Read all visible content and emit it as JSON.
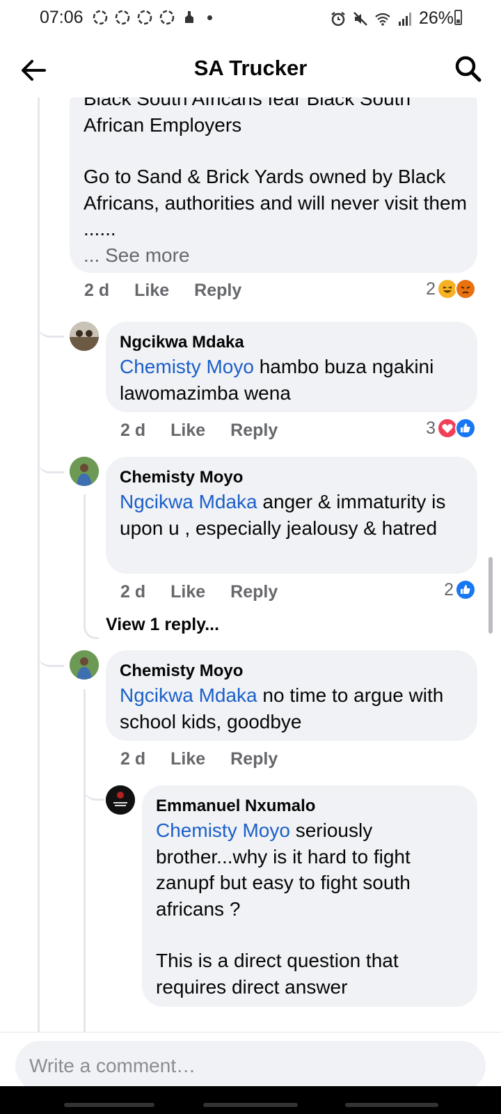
{
  "status_bar": {
    "time": "07:06",
    "battery": "26%",
    "notification_icons": [
      "app-icon",
      "app-icon",
      "app-icon",
      "app-icon",
      "app-icon"
    ],
    "right_icons": [
      "alarm-icon",
      "mute-icon",
      "wifi-icon",
      "signal-icon",
      "battery-icon"
    ]
  },
  "header": {
    "title": "SA Trucker"
  },
  "comments": [
    {
      "id": "c0",
      "text_partial_top": "Black South Africans fear Black South",
      "text_line2": "African Employers",
      "text_para2": "Go to Sand & Brick Yards owned by Black Africans, authorities and will never visit them ......",
      "see_more": "... See more",
      "time": "2 d",
      "like": "Like",
      "reply": "Reply",
      "reaction_count": "2",
      "reactions": [
        "haha",
        "angry"
      ]
    },
    {
      "id": "c1",
      "author": "Ngcikwa Mdaka",
      "mention": "Chemisty Moyo",
      "text": " hambo buza ngakini lawomazimba wena",
      "time": "2 d",
      "like": "Like",
      "reply": "Reply",
      "reaction_count": "3",
      "reactions": [
        "love",
        "like"
      ]
    },
    {
      "id": "c2",
      "author": "Chemisty Moyo",
      "mention": "Ngcikwa Mdaka",
      "text": " anger & immaturity is upon u , especially jealousy & hatred",
      "time": "2 d",
      "like": "Like",
      "reply": "Reply",
      "reaction_count": "2",
      "reactions": [
        "like"
      ],
      "view_replies": "View 1 reply..."
    },
    {
      "id": "c3",
      "author": "Chemisty Moyo",
      "mention": "Ngcikwa Mdaka",
      "text": " no time to argue with school kids, goodbye",
      "time": "2 d",
      "like": "Like",
      "reply": "Reply"
    },
    {
      "id": "c4",
      "author": "Emmanuel Nxumalo",
      "mention": "Chemisty Moyo",
      "text": " seriously brother...why is it hard to fight zanupf but easy to fight south africans ?",
      "text_para2": "This is a direct question that requires direct answer",
      "avatar_text": "NOT MY PRESIDENT"
    }
  ],
  "composer": {
    "placeholder": "Write a comment…"
  },
  "colors": {
    "bubble": "#f0f2f5",
    "mention": "#1b5fc9",
    "meta": "#65676b",
    "like_blue": "#1877f2",
    "love_red": "#f33e58",
    "haha_yellow": "#f7b125",
    "angry_orange": "#e9710f"
  }
}
